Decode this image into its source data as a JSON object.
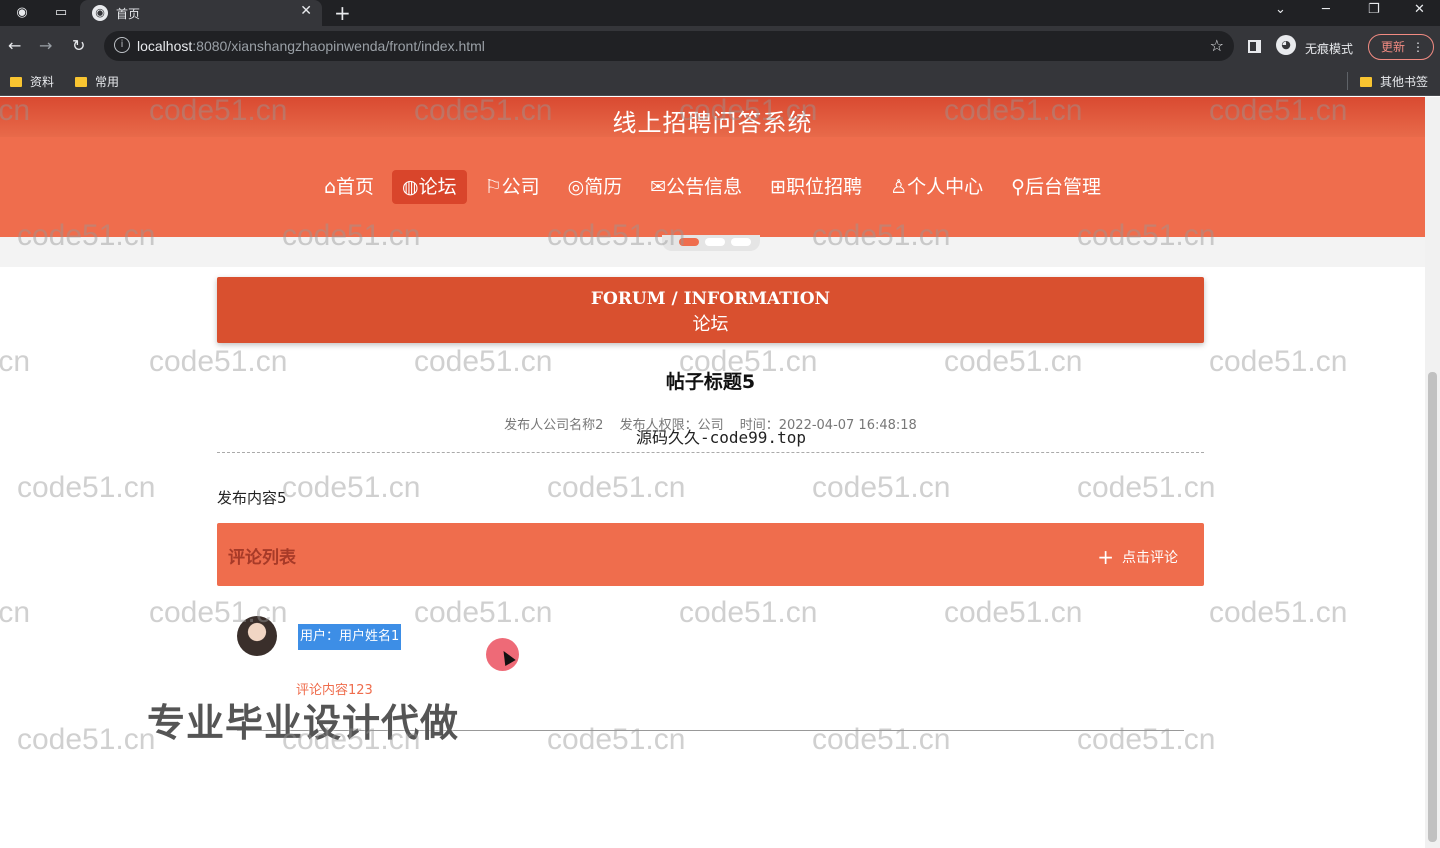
{
  "browser": {
    "tab_title": "首页",
    "url_host": "localhost",
    "url_rest": ":8080/xianshangzhaopinwenda/front/index.html",
    "incognito_label": "无痕模式",
    "update_label": "更新",
    "bookmarks": [
      "资料",
      "常用"
    ],
    "other_bookmarks": "其他书签"
  },
  "site": {
    "title": "线上招聘问答系统",
    "nav": [
      {
        "label": "⌂首页",
        "active": false
      },
      {
        "label": "◍论坛",
        "active": true
      },
      {
        "label": "⚐公司",
        "active": false
      },
      {
        "label": "◎简历",
        "active": false
      },
      {
        "label": "✉公告信息",
        "active": false
      },
      {
        "label": "⊞职位招聘",
        "active": false
      },
      {
        "label": "♙个人中心",
        "active": false
      },
      {
        "label": "⚲后台管理",
        "active": false
      }
    ]
  },
  "forum": {
    "banner_en": "FORUM / INFORMATION",
    "banner_zh": "论坛",
    "post_title": "帖子标题5",
    "meta_publisher": "发布人公司名称2",
    "meta_role": "发布人权限：公司",
    "meta_time": "时间：2022-04-07 16:48:18",
    "content": "发布内容5",
    "comment_list_label": "评论列表",
    "add_comment_label": "点击评论",
    "comments": [
      {
        "user": "用户：用户姓名1",
        "text": "评论内容123"
      }
    ]
  },
  "overlays": {
    "code_site": "源码久久-code99.top",
    "promo": "专业毕业设计代做",
    "watermark": "code51.cn"
  },
  "colors": {
    "accent": "#ef6d4d",
    "accent_dark": "#d9502f",
    "highlight": "#3d8ee6"
  }
}
